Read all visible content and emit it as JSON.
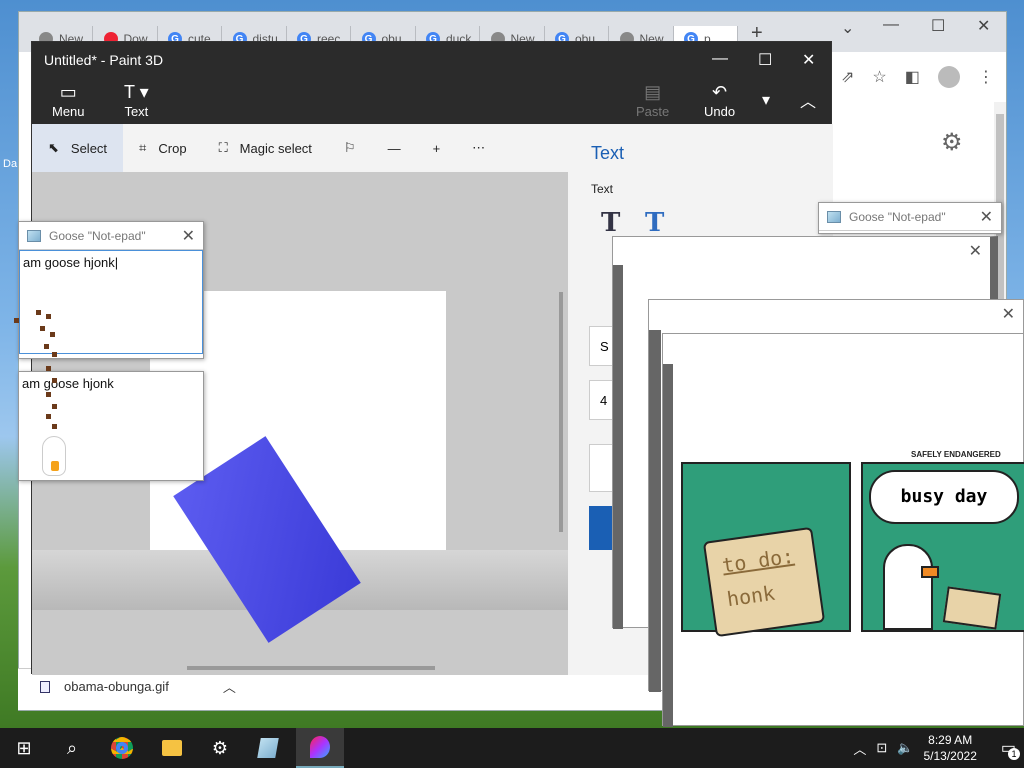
{
  "chrome": {
    "tabs": [
      {
        "label": "New",
        "fav": "chrome-icon"
      },
      {
        "label": "Dow",
        "fav": "store-icon"
      },
      {
        "label": "cute",
        "fav": "google-icon"
      },
      {
        "label": "distu",
        "fav": "google-icon"
      },
      {
        "label": "reec",
        "fav": "google-icon"
      },
      {
        "label": "obu",
        "fav": "google-icon"
      },
      {
        "label": "duck",
        "fav": "google-icon"
      },
      {
        "label": "New",
        "fav": "chrome-icon"
      },
      {
        "label": "obu",
        "fav": "google-icon"
      },
      {
        "label": "New",
        "fav": "chrome-icon"
      },
      {
        "label": "p",
        "fav": "google-icon"
      }
    ],
    "download": {
      "filename": "obama-obunga.gif"
    }
  },
  "paint3d": {
    "title": "Untitled* - Paint 3D",
    "menu_label": "Menu",
    "text_label": "Text",
    "paste_label": "Paste",
    "undo_label": "Undo",
    "tools": {
      "select": "Select",
      "crop": "Crop",
      "magic_select": "Magic select"
    },
    "side": {
      "heading": "Text",
      "label": "Text",
      "field1": "S",
      "field2": "4"
    }
  },
  "notepads": [
    {
      "title": "Goose \"Not-epad\"",
      "text": "am goose hjonk"
    },
    {
      "title": "Goose \"Not-epad\"",
      "text": "am goose hjonk"
    },
    {
      "title": "Goose \"Not-epad\"",
      "text": ""
    }
  ],
  "meme": {
    "brand": "SAFELY ENDANGERED",
    "note_line1": "to do:",
    "note_line2": "honk",
    "bubble": "busy day"
  },
  "taskbar": {
    "time": "8:29 AM",
    "date": "5/13/2022",
    "notification_count": "1"
  },
  "desktop": {
    "icon_label": "Da"
  },
  "colors": {
    "accent": "#1a5fb4",
    "paint_dark": "#2b2b2b",
    "meme_green": "#2f9e7a"
  }
}
